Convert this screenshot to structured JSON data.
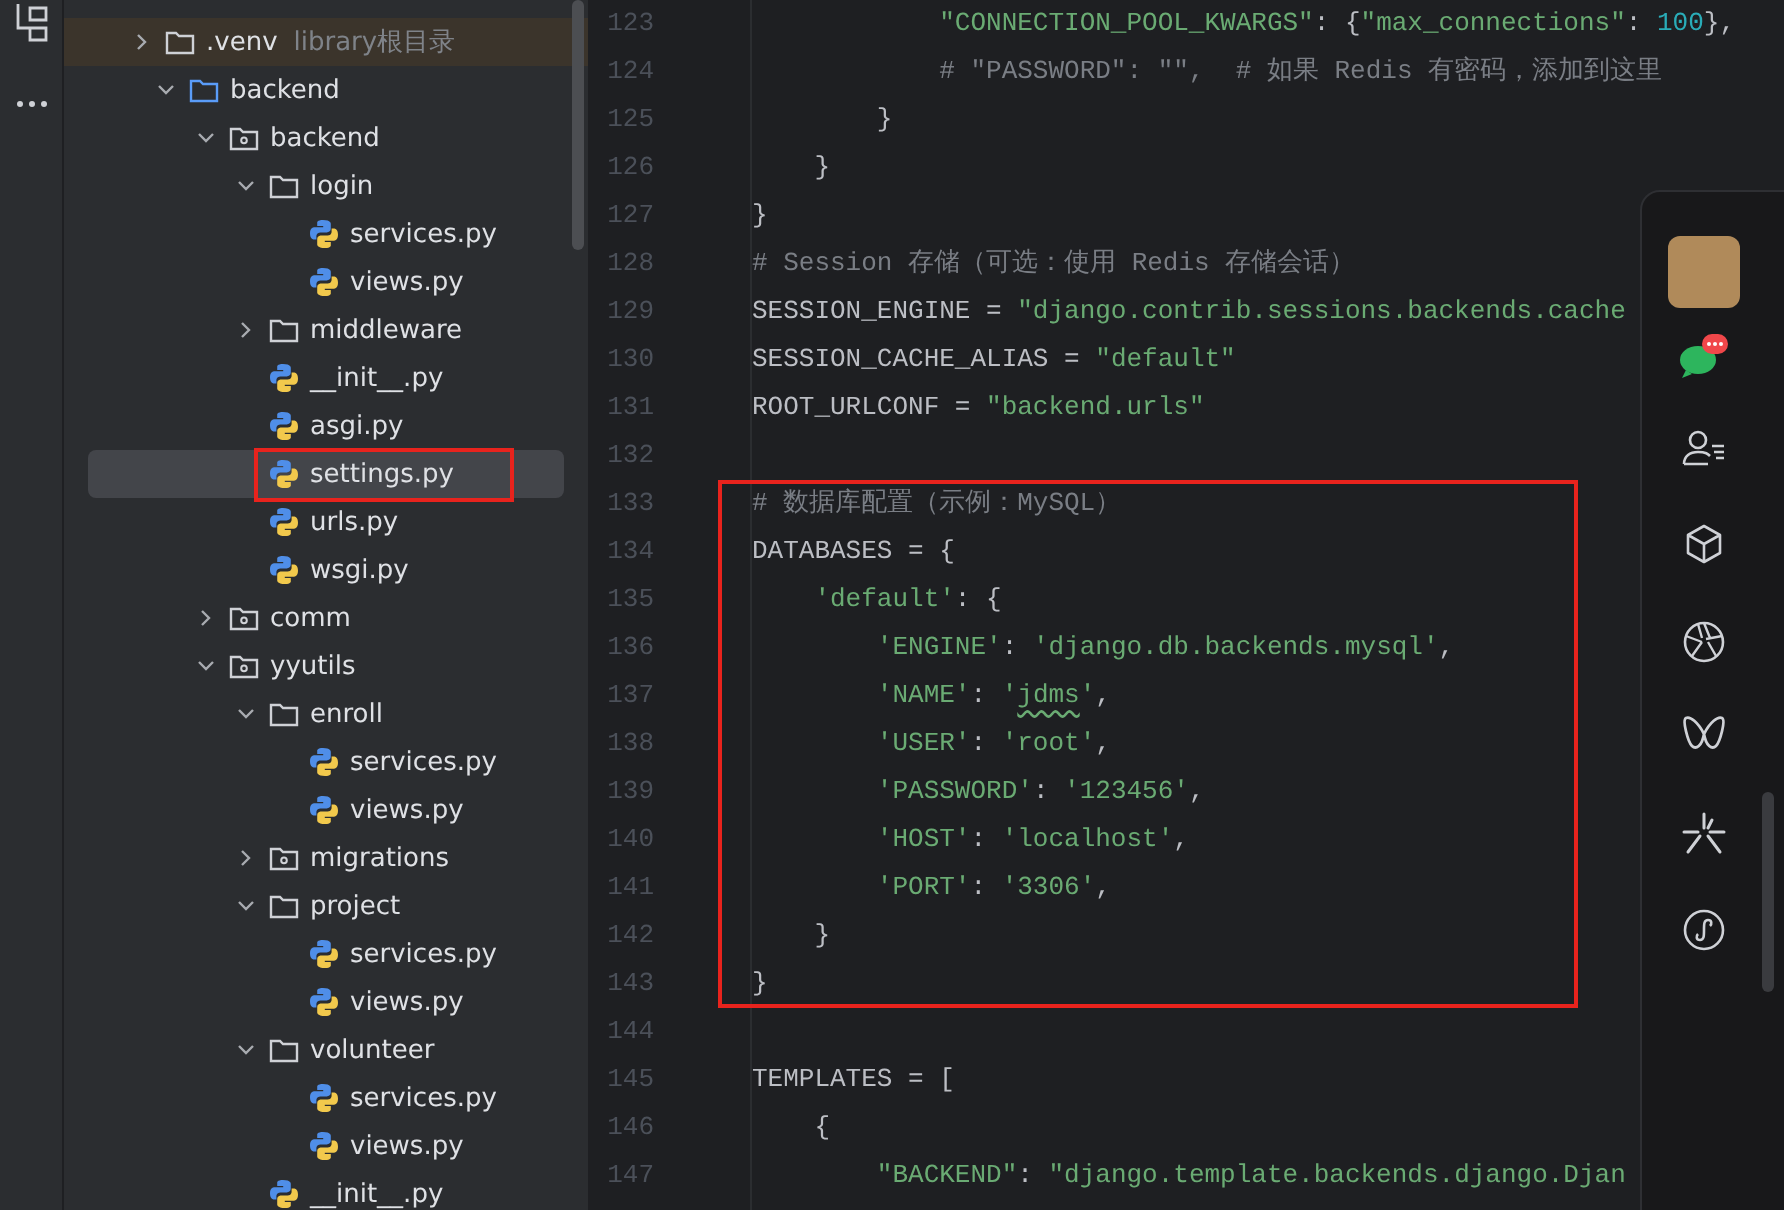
{
  "tree": {
    "items": [
      {
        "kind": "library",
        "label": ".venv",
        "hint": "library根目录",
        "expanded": false,
        "selected": false,
        "framed": false
      },
      {
        "kind": "root-folder",
        "label": "backend",
        "expanded": true,
        "selected": false,
        "framed": false,
        "children": [
          {
            "kind": "package",
            "label": "backend",
            "expanded": true,
            "selected": false,
            "framed": false,
            "children": [
              {
                "kind": "folder",
                "label": "login",
                "expanded": true,
                "selected": false,
                "framed": false,
                "children": [
                  {
                    "kind": "python",
                    "label": "services.py",
                    "selected": false,
                    "framed": false
                  },
                  {
                    "kind": "python",
                    "label": "views.py",
                    "selected": false,
                    "framed": false
                  }
                ]
              },
              {
                "kind": "folder",
                "label": "middleware",
                "expanded": false,
                "selected": false,
                "framed": false
              },
              {
                "kind": "python",
                "label": "__init__.py",
                "selected": false,
                "framed": false
              },
              {
                "kind": "python",
                "label": "asgi.py",
                "selected": false,
                "framed": false
              },
              {
                "kind": "python",
                "label": "settings.py",
                "selected": true,
                "framed": true
              },
              {
                "kind": "python",
                "label": "urls.py",
                "selected": false,
                "framed": false
              },
              {
                "kind": "python",
                "label": "wsgi.py",
                "selected": false,
                "framed": false
              }
            ]
          },
          {
            "kind": "package",
            "label": "comm",
            "expanded": false,
            "selected": false,
            "framed": false
          },
          {
            "kind": "package",
            "label": "yyutils",
            "expanded": true,
            "selected": false,
            "framed": false,
            "children": [
              {
                "kind": "folder",
                "label": "enroll",
                "expanded": true,
                "selected": false,
                "framed": false,
                "children": [
                  {
                    "kind": "python",
                    "label": "services.py",
                    "selected": false,
                    "framed": false
                  },
                  {
                    "kind": "python",
                    "label": "views.py",
                    "selected": false,
                    "framed": false
                  }
                ]
              },
              {
                "kind": "package",
                "label": "migrations",
                "expanded": false,
                "selected": false,
                "framed": false
              },
              {
                "kind": "folder",
                "label": "project",
                "expanded": true,
                "selected": false,
                "framed": false,
                "children": [
                  {
                    "kind": "python",
                    "label": "services.py",
                    "selected": false,
                    "framed": false
                  },
                  {
                    "kind": "python",
                    "label": "views.py",
                    "selected": false,
                    "framed": false
                  }
                ]
              },
              {
                "kind": "folder",
                "label": "volunteer",
                "expanded": true,
                "selected": false,
                "framed": false,
                "children": [
                  {
                    "kind": "python",
                    "label": "services.py",
                    "selected": false,
                    "framed": false
                  },
                  {
                    "kind": "python",
                    "label": "views.py",
                    "selected": false,
                    "framed": false
                  }
                ]
              },
              {
                "kind": "python",
                "label": "__init__.py",
                "selected": false,
                "framed": false
              }
            ]
          }
        ]
      }
    ]
  },
  "code": {
    "lines": [
      {
        "number": "123",
        "framed": false,
        "tokens": [
          {
            "kind": "string",
            "text": "            \"CONNECTION_POOL_KWARGS\""
          },
          {
            "kind": "plain",
            "text": ": {"
          },
          {
            "kind": "string",
            "text": "\"max_connections\""
          },
          {
            "kind": "plain",
            "text": ": "
          },
          {
            "kind": "number",
            "text": "100"
          },
          {
            "kind": "plain",
            "text": "},"
          }
        ]
      },
      {
        "number": "124",
        "framed": false,
        "tokens": [
          {
            "kind": "comment",
            "text": "            # \"PASSWORD\": \"\",  # 如果 Redis 有密码，添加到这里"
          }
        ]
      },
      {
        "number": "125",
        "framed": false,
        "tokens": [
          {
            "kind": "plain",
            "text": "        }"
          }
        ]
      },
      {
        "number": "126",
        "framed": false,
        "tokens": [
          {
            "kind": "plain",
            "text": "    }"
          }
        ]
      },
      {
        "number": "127",
        "framed": false,
        "tokens": [
          {
            "kind": "plain",
            "text": "}"
          }
        ]
      },
      {
        "number": "128",
        "framed": false,
        "tokens": [
          {
            "kind": "comment",
            "text": "# Session 存储（可选：使用 Redis 存储会话）"
          }
        ]
      },
      {
        "number": "129",
        "framed": false,
        "tokens": [
          {
            "kind": "plain",
            "text": "SESSION_ENGINE = "
          },
          {
            "kind": "string",
            "text": "\"django.contrib.sessions.backends.cache"
          }
        ]
      },
      {
        "number": "130",
        "framed": false,
        "tokens": [
          {
            "kind": "plain",
            "text": "SESSION_CACHE_ALIAS = "
          },
          {
            "kind": "string",
            "text": "\"default\""
          }
        ]
      },
      {
        "number": "131",
        "framed": false,
        "tokens": [
          {
            "kind": "plain",
            "text": "ROOT_URLCONF = "
          },
          {
            "kind": "string",
            "text": "\"backend.urls\""
          }
        ]
      },
      {
        "number": "132",
        "framed": false
      },
      {
        "number": "133",
        "framed": true,
        "tokens": [
          {
            "kind": "comment",
            "text": "# 数据库配置（示例：MySQL）"
          }
        ]
      },
      {
        "number": "134",
        "framed": true,
        "tokens": [
          {
            "kind": "plain",
            "text": "DATABASES = {"
          }
        ]
      },
      {
        "number": "135",
        "framed": true,
        "tokens": [
          {
            "kind": "string",
            "text": "    'default'"
          },
          {
            "kind": "plain",
            "text": ": {"
          }
        ]
      },
      {
        "number": "136",
        "framed": true,
        "tokens": [
          {
            "kind": "string",
            "text": "        'ENGINE'"
          },
          {
            "kind": "plain",
            "text": ": "
          },
          {
            "kind": "string",
            "text": "'django.db.backends.mysql'"
          },
          {
            "kind": "plain",
            "text": ","
          }
        ]
      },
      {
        "number": "137",
        "framed": true,
        "tokens": [
          {
            "kind": "string",
            "text": "        'NAME'"
          },
          {
            "kind": "plain",
            "text": ": "
          },
          {
            "kind": "string",
            "text": "'"
          },
          {
            "kind": "typo",
            "text": "jdms"
          },
          {
            "kind": "string",
            "text": "'"
          },
          {
            "kind": "plain",
            "text": ","
          }
        ]
      },
      {
        "number": "138",
        "framed": true,
        "tokens": [
          {
            "kind": "string",
            "text": "        'USER'"
          },
          {
            "kind": "plain",
            "text": ": "
          },
          {
            "kind": "string",
            "text": "'root'"
          },
          {
            "kind": "plain",
            "text": ","
          }
        ]
      },
      {
        "number": "139",
        "framed": true,
        "tokens": [
          {
            "kind": "string",
            "text": "        'PASSWORD'"
          },
          {
            "kind": "plain",
            "text": ": "
          },
          {
            "kind": "string",
            "text": "'123456'"
          },
          {
            "kind": "plain",
            "text": ","
          }
        ]
      },
      {
        "number": "140",
        "framed": true,
        "tokens": [
          {
            "kind": "string",
            "text": "        'HOST'"
          },
          {
            "kind": "plain",
            "text": ": "
          },
          {
            "kind": "string",
            "text": "'localhost'"
          },
          {
            "kind": "plain",
            "text": ","
          }
        ]
      },
      {
        "number": "141",
        "framed": true,
        "tokens": [
          {
            "kind": "string",
            "text": "        'PORT'"
          },
          {
            "kind": "plain",
            "text": ": "
          },
          {
            "kind": "string",
            "text": "'3306'"
          },
          {
            "kind": "plain",
            "text": ","
          }
        ]
      },
      {
        "number": "142",
        "framed": true,
        "tokens": [
          {
            "kind": "plain",
            "text": "    }"
          }
        ]
      },
      {
        "number": "143",
        "framed": true,
        "tokens": [
          {
            "kind": "plain",
            "text": "}"
          }
        ]
      },
      {
        "number": "144",
        "framed": false
      },
      {
        "number": "145",
        "framed": false,
        "tokens": [
          {
            "kind": "plain",
            "text": "TEMPLATES = ["
          }
        ]
      },
      {
        "number": "146",
        "framed": false,
        "tokens": [
          {
            "kind": "plain",
            "text": "    {"
          }
        ]
      },
      {
        "number": "147",
        "framed": false,
        "tokens": [
          {
            "kind": "string",
            "text": "        \"BACKEND\""
          },
          {
            "kind": "plain",
            "text": ": "
          },
          {
            "kind": "string",
            "text": "\"django.template.backends.django.Djan"
          }
        ]
      }
    ]
  }
}
